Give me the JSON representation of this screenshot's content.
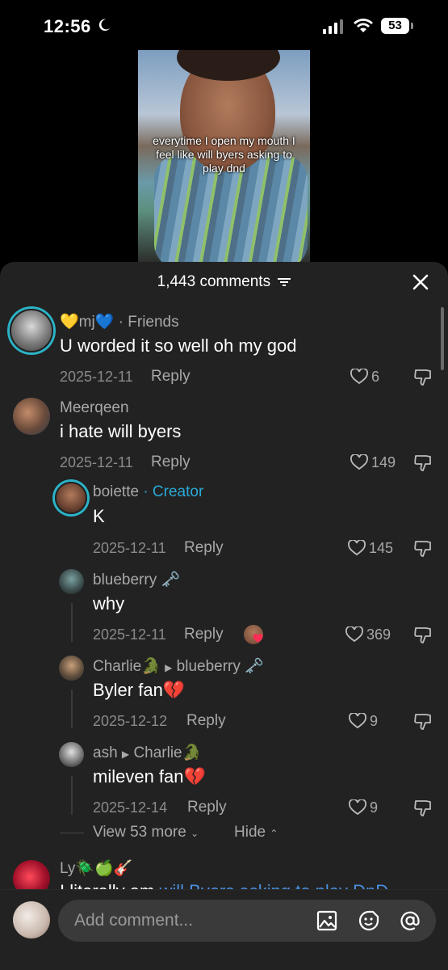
{
  "status_bar": {
    "time": "12:56",
    "battery": "53"
  },
  "video": {
    "caption": "everytime I open my mouth I feel like will byers asking to play dnd"
  },
  "sheet": {
    "title": "1,443 comments"
  },
  "comments": [
    {
      "user": "💛mj💙",
      "tag": "· Friends",
      "text": "U worded it so well oh my god",
      "date": "2025-12-11",
      "reply": "Reply",
      "likes": "6"
    },
    {
      "user": "Meerqeen",
      "text": "i hate will byers",
      "date": "2025-12-11",
      "reply": "Reply",
      "likes": "149"
    }
  ],
  "replies": [
    {
      "user": "boiette",
      "tag": "· Creator",
      "text": "K",
      "date": "2025-12-11",
      "reply": "Reply",
      "likes": "145"
    },
    {
      "user": "blueberry 🗝️",
      "text": "why",
      "date": "2025-12-11",
      "reply": "Reply",
      "likes": "369"
    },
    {
      "user": "Charlie🐊",
      "to": "blueberry 🗝️",
      "text": "Byler fan💔",
      "date": "2025-12-12",
      "reply": "Reply",
      "likes": "9"
    },
    {
      "user": "ash",
      "to": "Charlie🐊",
      "text": "mileven fan💔",
      "date": "2025-12-14",
      "reply": "Reply",
      "likes": "9"
    }
  ],
  "view_more": "View 53 more",
  "hide": "Hide",
  "partial_comment": {
    "user": "Ly🪲🍏🎸",
    "text_start": "I literally am ",
    "link": "will Byers asking to play DnD"
  },
  "input": {
    "placeholder": "Add comment..."
  },
  "icons": [
    "moon-icon",
    "signal-icon",
    "wifi-icon",
    "filter-icon",
    "close-icon",
    "heart-icon",
    "dislike-icon",
    "image-icon",
    "emoji-icon",
    "mention-icon"
  ],
  "colors": {
    "background": "#222222",
    "accent_creator": "#2aa9d6",
    "ring": "#2bb3c7",
    "link": "#4a90e2"
  }
}
